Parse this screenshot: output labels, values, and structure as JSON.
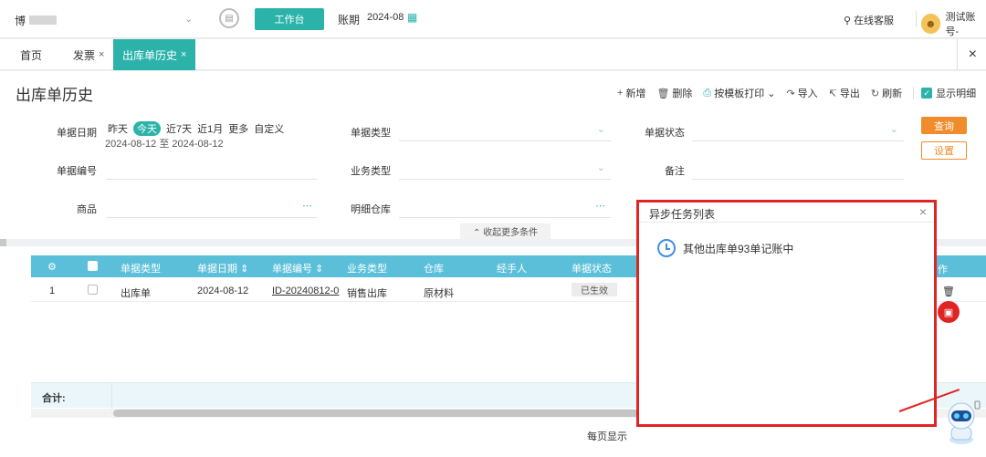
{
  "topbar": {
    "company_name": "博",
    "workbench_label": "工作台",
    "period_label": "账期",
    "period_value": "2024-08",
    "support_label": "在线客服",
    "user_name": "测试账号-"
  },
  "tabs": [
    {
      "label": "首页"
    },
    {
      "label": "发票"
    },
    {
      "label": "出库单历史"
    }
  ],
  "page": {
    "title": "出库单历史"
  },
  "toolbar": {
    "add": "新增",
    "delete": "删除",
    "print_template": "按模板打印",
    "import": "导入",
    "export": "导出",
    "refresh": "刷新",
    "show_detail": "显示明细"
  },
  "filters": {
    "doc_date_label": "单据日期",
    "date_chips": [
      "昨天",
      "今天",
      "近7天",
      "近1月",
      "更多",
      "自定义"
    ],
    "date_range": "2024-08-12 至 2024-08-12",
    "doc_type_label": "单据类型",
    "doc_status_label": "单据状态",
    "doc_no_label": "单据编号",
    "biz_type_label": "业务类型",
    "remark_label": "备注",
    "product_label": "商品",
    "detail_wh_label": "明细仓库",
    "query_button": "查询",
    "setting_button": "设置",
    "collapse_label": "收起更多条件"
  },
  "grid": {
    "columns": [
      "单据类型",
      "单据日期",
      "单据编号",
      "业务类型",
      "仓库",
      "经手人",
      "单据状态"
    ],
    "op_column": "作",
    "rows": [
      {
        "index": "1",
        "doc_type": "出库单",
        "date": "2024-08-12",
        "doc_no": "ID-20240812-0",
        "biz_type": "销售出库",
        "warehouse": "原材料",
        "handler": "",
        "status": "已生效"
      }
    ],
    "sum_label": "合计:",
    "page_size_label": "每页显示"
  },
  "popup": {
    "title": "异步任务列表",
    "task_text": "其他出库单93单记账中"
  },
  "colors": {
    "accent": "#2bb3aa",
    "grid_header": "#5bbfd9",
    "orange": "#f08c2b",
    "highlight_red": "#e02424"
  }
}
